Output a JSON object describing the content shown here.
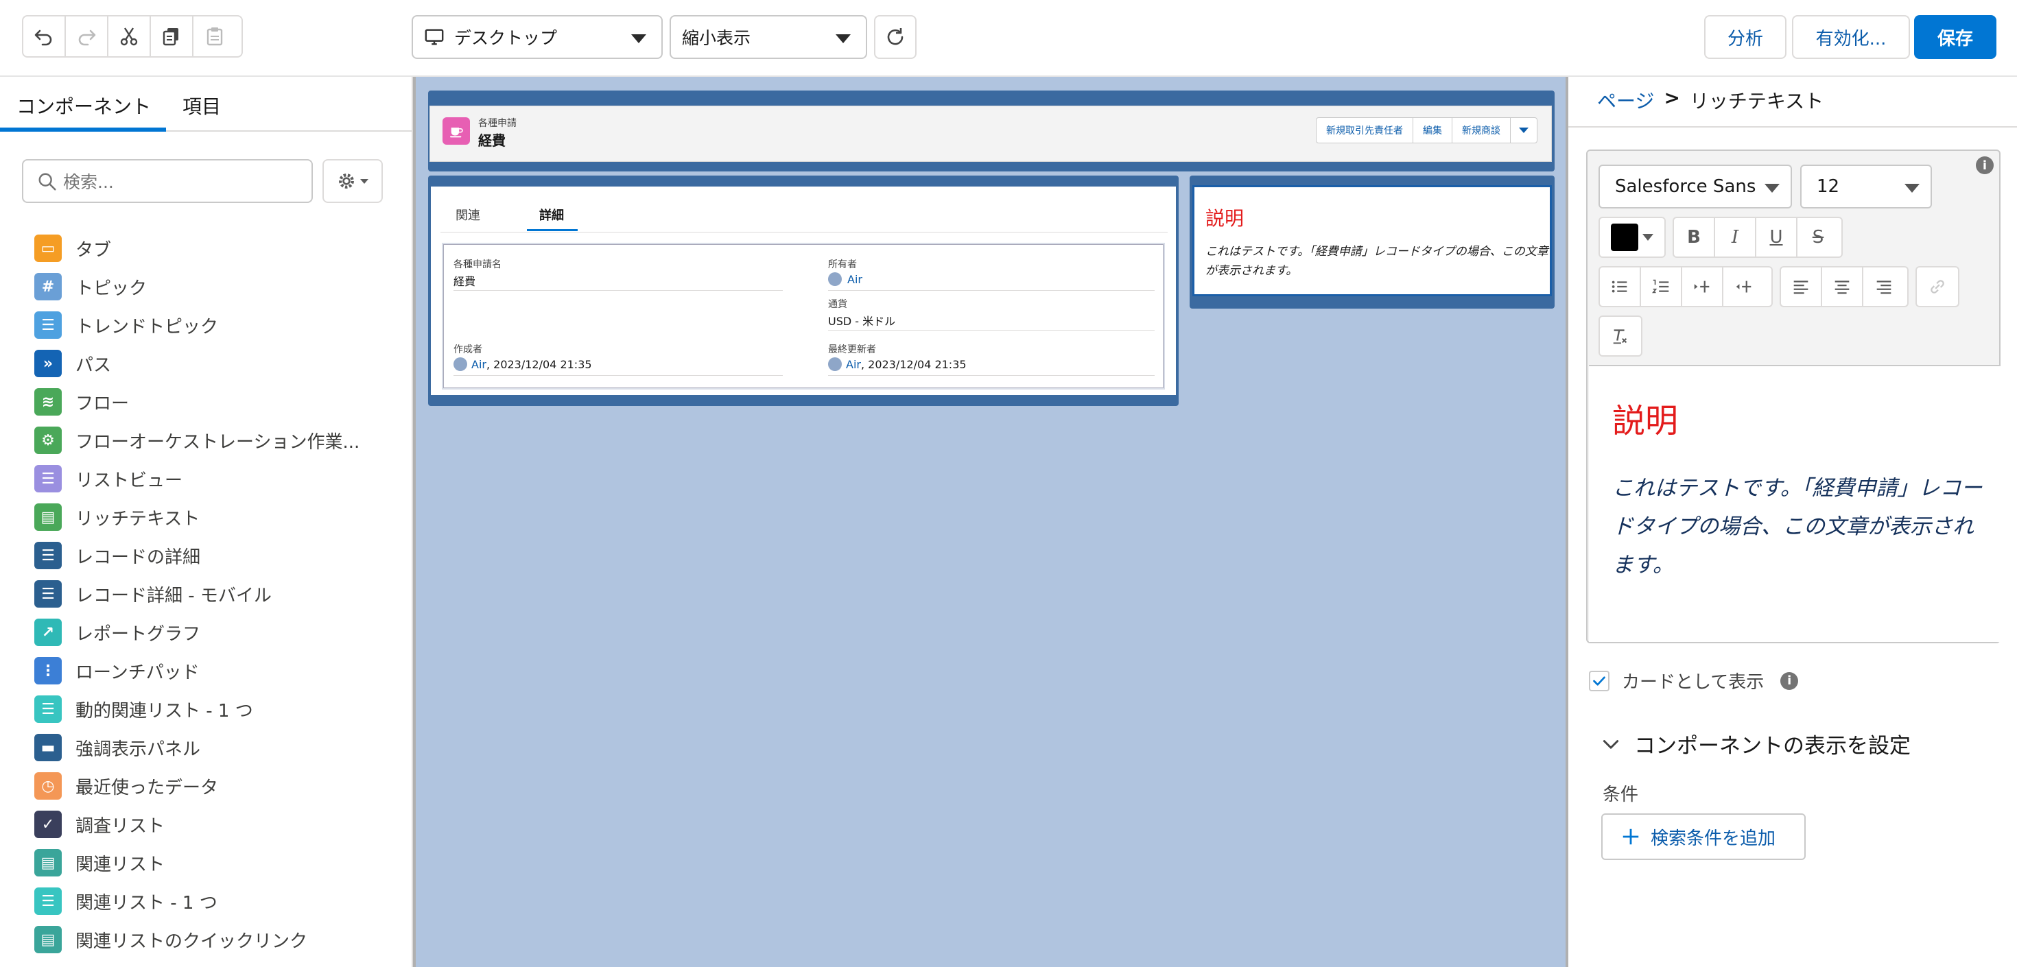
{
  "toolbar": {
    "device_select": "デスクトップ",
    "view_select": "縮小表示",
    "analyze": "分析",
    "activate": "有効化...",
    "save": "保存"
  },
  "left": {
    "tabs": [
      "コンポーネント",
      "項目"
    ],
    "search_placeholder": "検索...",
    "components": [
      {
        "label": "タブ",
        "color": "#f59d24",
        "icon": "tab-icon"
      },
      {
        "label": "トピック",
        "color": "#6a9fd6",
        "icon": "hash-icon"
      },
      {
        "label": "トレンドトピック",
        "color": "#4ea1e0",
        "icon": "list-icon"
      },
      {
        "label": "パス",
        "color": "#1464b4",
        "icon": "path-icon"
      },
      {
        "label": "フロー",
        "color": "#4aa859",
        "icon": "flow-icon"
      },
      {
        "label": "フローオーケストレーション作業...",
        "color": "#4aa859",
        "icon": "orchestration-icon"
      },
      {
        "label": "リストビュー",
        "color": "#9a8fe0",
        "icon": "list-view-icon"
      },
      {
        "label": "リッチテキスト",
        "color": "#4aa859",
        "icon": "rich-text-icon"
      },
      {
        "label": "レコードの詳細",
        "color": "#2b5f8f",
        "icon": "record-detail-icon"
      },
      {
        "label": "レコード詳細 - モバイル",
        "color": "#2b5f8f",
        "icon": "record-detail-mobile-icon"
      },
      {
        "label": "レポートグラフ",
        "color": "#2fb9b6",
        "icon": "report-chart-icon"
      },
      {
        "label": "ローンチパッド",
        "color": "#3c7fd6",
        "icon": "launchpad-icon"
      },
      {
        "label": "動的関連リスト - 1 つ",
        "color": "#38c5c1",
        "icon": "dynamic-list-icon"
      },
      {
        "label": "強調表示パネル",
        "color": "#2b5f8f",
        "icon": "highlights-panel-icon"
      },
      {
        "label": "最近使ったデータ",
        "color": "#f49756",
        "icon": "recent-icon"
      },
      {
        "label": "調査リスト",
        "color": "#3a3f5c",
        "icon": "survey-icon"
      },
      {
        "label": "関連リスト",
        "color": "#3aa59a",
        "icon": "related-list-icon"
      },
      {
        "label": "関連リスト - 1 つ",
        "color": "#38c5c1",
        "icon": "related-list-single-icon"
      },
      {
        "label": "関連リストのクイックリンク",
        "color": "#3aa59a",
        "icon": "quick-links-icon"
      }
    ]
  },
  "canvas": {
    "object_subtitle": "各種申請",
    "object_title": "経費",
    "header_buttons": [
      "新規取引先責任者",
      "編集",
      "新規商談"
    ],
    "record_tabs": [
      "関連",
      "詳細"
    ],
    "fields": {
      "name_label": "各種申請名",
      "name_value": "経費",
      "owner_label": "所有者",
      "owner_value": "Air",
      "currency_label": "通貨",
      "currency_value": "USD - 米ドル",
      "created_label": "作成者",
      "created_user": "Air",
      "created_date": ", 2023/12/04 21:35",
      "modified_label": "最終更新者",
      "modified_user": "Air",
      "modified_date": ", 2023/12/04 21:35"
    },
    "rich_title": "説明",
    "rich_body": "これはテストです。「経費申請」レコードタイプの場合、この文章が表示されます。"
  },
  "right": {
    "breadcrumb_link": "ページ",
    "breadcrumb_sep": ">",
    "breadcrumb_current": "リッチテキスト",
    "font_family": "Salesforce Sans",
    "font_size": "12",
    "text_color": "#000000",
    "editor_title": "説明",
    "editor_body": "これはテストです。「経費申請」レコードタイプの場合、この文章が表示されます。",
    "show_as_card": "カードとして表示",
    "visibility_section": "コンポーネントの表示を設定",
    "conditions_label": "条件",
    "add_filter": "検索条件を追加"
  }
}
